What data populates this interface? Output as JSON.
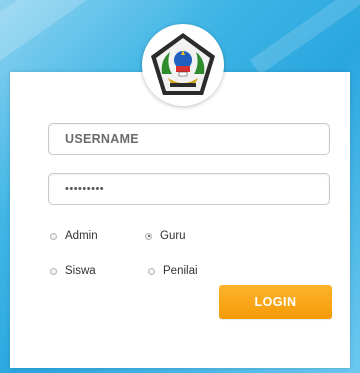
{
  "login": {
    "username_placeholder": "USERNAME",
    "password_value": "•••••••••",
    "button_label": "LOGIN"
  },
  "roles": {
    "options": [
      {
        "label": "Admin",
        "checked": false
      },
      {
        "label": "Guru",
        "checked": true
      },
      {
        "label": "Siswa",
        "checked": false
      },
      {
        "label": "Penilai",
        "checked": false
      }
    ]
  },
  "colors": {
    "accent": "#f7a414",
    "background": "#2aa6df"
  },
  "logo": {
    "icon": "pentagon-school-emblem-icon"
  }
}
